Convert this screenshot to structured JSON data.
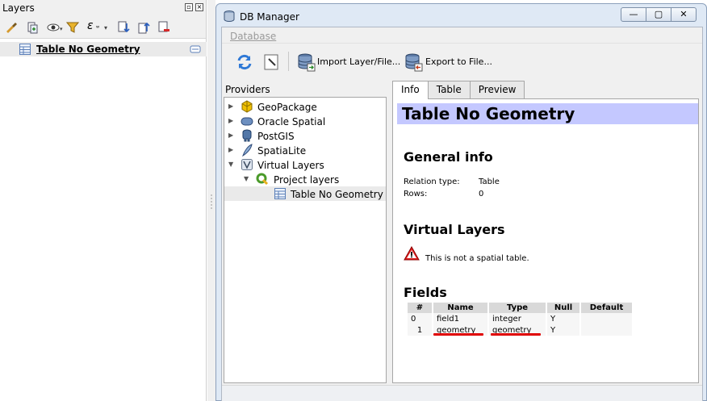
{
  "layers_panel": {
    "title": "Layers",
    "layer": {
      "name": "Table No Geometry"
    }
  },
  "db_manager": {
    "title": "DB Manager",
    "window_buttons": {
      "minimize": "—",
      "maximize": "▢",
      "close": "✕"
    },
    "menu": {
      "database": "Database"
    },
    "toolbar": {
      "import_label": "Import Layer/File...",
      "export_label": "Export to File..."
    },
    "providers": {
      "label": "Providers",
      "items": [
        {
          "label": "GeoPackage"
        },
        {
          "label": "Oracle Spatial"
        },
        {
          "label": "PostGIS"
        },
        {
          "label": "SpatiaLite"
        },
        {
          "label": "Virtual Layers"
        },
        {
          "label": "Project layers"
        },
        {
          "label": "Table No Geometry"
        }
      ]
    },
    "tabs": [
      {
        "label": "Info"
      },
      {
        "label": "Table"
      },
      {
        "label": "Preview"
      }
    ],
    "info": {
      "table_title": "Table No Geometry",
      "general_heading": "General info",
      "relation_type_label": "Relation type:",
      "relation_type_value": "Table",
      "rows_label": "Rows:",
      "rows_value": "0",
      "virtual_heading": "Virtual Layers",
      "warning_text": "This is not a spatial table.",
      "fields_heading": "Fields",
      "fields_columns": [
        "#",
        "Name",
        "Type",
        "Null",
        "Default"
      ],
      "fields_rows": [
        [
          "0",
          "field1",
          "integer",
          "Y",
          ""
        ],
        [
          "1",
          "geometry",
          "geometry",
          "Y",
          ""
        ]
      ]
    }
  },
  "colors": {
    "info_header_bg": "#c4c8ff",
    "highlight_underline": "#e00000",
    "window_frame": "#dfe9f5"
  }
}
